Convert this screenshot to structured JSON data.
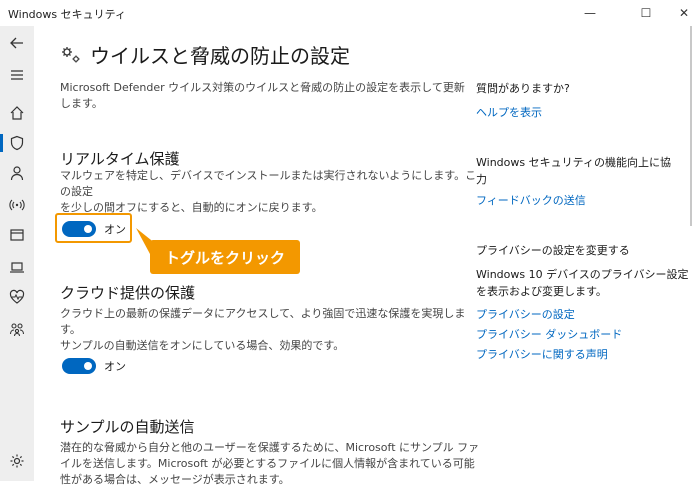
{
  "window": {
    "title": "Windows セキュリティ",
    "min": "—",
    "max": "☐",
    "close": "✕"
  },
  "sidebar": {
    "items": [
      {
        "name": "back-arrow-icon"
      },
      {
        "name": "menu-icon"
      },
      {
        "name": "home-icon"
      },
      {
        "name": "shield-icon",
        "active": true
      },
      {
        "name": "person-icon"
      },
      {
        "name": "wifi-icon"
      },
      {
        "name": "app-browser-icon"
      },
      {
        "name": "laptop-icon"
      },
      {
        "name": "heart-icon"
      },
      {
        "name": "family-icon"
      },
      {
        "name": "gear-icon"
      }
    ]
  },
  "main": {
    "title": "ウイルスと脅威の防止の設定",
    "intro_line1": "Microsoft Defender ウイルス対策のウイルスと脅威の防止の設定を表示して更新",
    "intro_line2": "します。",
    "sections": [
      {
        "title": "リアルタイム保護",
        "desc_line1": "マルウェアを特定し、デバイスでインストールまたは実行されないようにします。この設定",
        "desc_line2": "を少しの間オフにすると、自動的にオンに戻ります。",
        "toggle_label": "オン"
      },
      {
        "title": "クラウド提供の保護",
        "desc_line1": "クラウド上の最新の保護データにアクセスして、より強固で迅速な保護を実現します。",
        "desc_line2": "サンプルの自動送信をオンにしている場合、効果的です。",
        "toggle_label": "オン"
      },
      {
        "title": "サンプルの自動送信",
        "desc_line1": "潜在的な脅威から自分と他のユーザーを保護するために、Microsoft にサンプル ファ",
        "desc_line2": "イルを送信します。Microsoft が必要とするファイルに個人情報が含まれている可能",
        "desc_line3": "性がある場合は、メッセージが表示されます。"
      }
    ],
    "callout": "トグルをクリック"
  },
  "right_panel": {
    "question": "質問がありますか?",
    "help_link": "ヘルプを表示",
    "improve_line1": "Windows セキュリティの機能向上に協",
    "improve_line2": "力",
    "feedback_link": "フィードバックの送信",
    "privacy_heading": "プライバシーの設定を変更する",
    "privacy_desc_line1": "Windows 10 デバイスのプライバシー設定",
    "privacy_desc_line2": "を表示および変更します。",
    "privacy_links": [
      "プライバシーの設定",
      "プライバシー ダッシュボード",
      "プライバシーに関する声明"
    ]
  },
  "colors": {
    "accent": "#0067c0",
    "callout": "#f39800",
    "sidebar_bg": "#eeeeee"
  }
}
